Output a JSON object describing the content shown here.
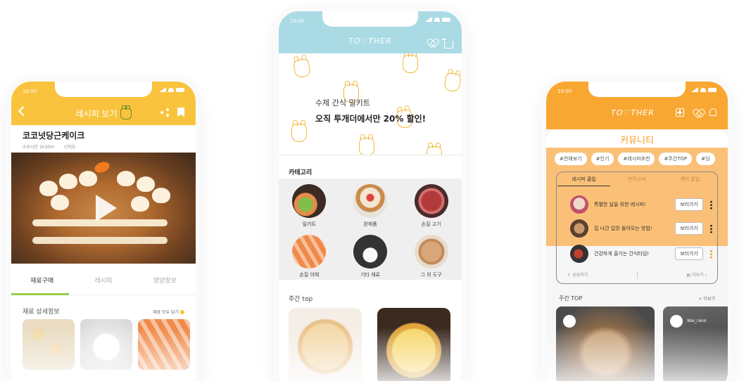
{
  "phone1": {
    "status_time": "10:00",
    "header_title": "레시피 보기",
    "recipe_title": "코코넛당근케이크",
    "meta_time": "소요시간 1h30m",
    "meta_difficulty": "난이도",
    "tabs": [
      "재료구매",
      "레시피",
      "영양정보"
    ],
    "section_title": "재료 상세정보",
    "section_action": "재료 모두 담기",
    "thumb_labels": [
      "",
      "",
      ""
    ]
  },
  "phone2": {
    "status_time": "10:00",
    "logo": "TO♡THER",
    "banner_sub": "수제 간식 밀키트",
    "banner_main": "오직 투개더에서만 20% 할인!",
    "category_title": "카테고리",
    "categories": [
      "밀키트",
      "완제품",
      "손질 고기",
      "손질 야채",
      "기타 재료",
      "그 외 도구"
    ],
    "weekly_title": "주간 top"
  },
  "phone3": {
    "status_time": "10:00",
    "logo": "TO♡THER",
    "community_title": "커뮤니티",
    "chips": [
      "#전체보기",
      "#인기",
      "#레시피추천",
      "#주간TOP",
      "#딩"
    ],
    "tabs": [
      "레시피 클립",
      "반려상식",
      "케어 꿀팁"
    ],
    "tips": [
      {
        "text": "특별한 날을 위한 레시피!",
        "button": "보러가기"
      },
      {
        "text": "집 나간 입맛 돌아오는 방법!",
        "button": "보러가기"
      },
      {
        "text": "건강하게 즐기는 간식타임!",
        "button": "보러가기"
      }
    ],
    "share_label": "공유하기",
    "more_label": "더보기",
    "weekly_title": "주간 TOP",
    "weekly_more": "+ 더보기",
    "post_users": [
      "",
      "Wai_rano"
    ]
  },
  "colors": {
    "phone1_accent": "#f9c33d",
    "phone2_accent": "#aadbe5",
    "phone3_accent": "#f9a733",
    "tab_active": "#9ccd4a"
  }
}
